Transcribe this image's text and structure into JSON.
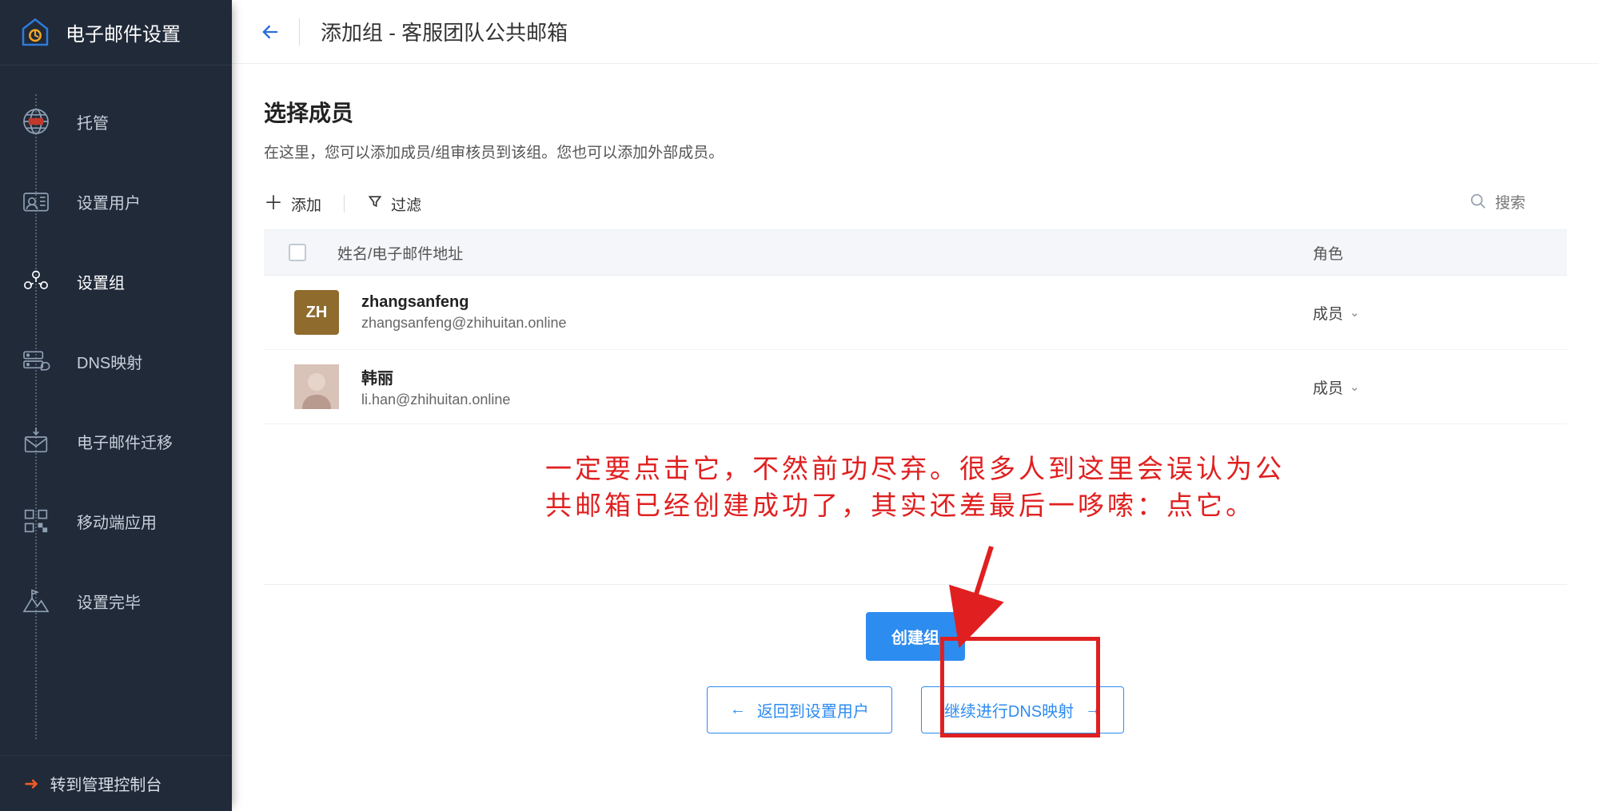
{
  "brand": {
    "title": "电子邮件设置"
  },
  "sidebar": {
    "items": [
      {
        "label": "托管"
      },
      {
        "label": "设置用户"
      },
      {
        "label": "设置组"
      },
      {
        "label": "DNS映射"
      },
      {
        "label": "电子邮件迁移"
      },
      {
        "label": "移动端应用"
      },
      {
        "label": "设置完毕"
      }
    ],
    "footer_label": "转到管理控制台"
  },
  "header": {
    "title": "添加组 - 客服团队公共邮箱"
  },
  "section": {
    "title": "选择成员",
    "desc": "在这里，您可以添加成员/组审核员到该组。您也可以添加外部成员。"
  },
  "toolbar": {
    "add_label": "添加",
    "filter_label": "过滤",
    "search_placeholder": "搜索"
  },
  "table": {
    "col_name": "姓名/电子邮件地址",
    "col_role": "角色",
    "rows": [
      {
        "initials": "ZH",
        "name": "zhangsanfeng",
        "email": "zhangsanfeng@zhihuitan.online",
        "role": "成员",
        "avatar_type": "initials",
        "avatar_color": "#8f6b2d"
      },
      {
        "initials": "",
        "name": "韩丽",
        "email": "li.han@zhihuitan.online",
        "role": "成员",
        "avatar_type": "photo"
      }
    ]
  },
  "annotation": {
    "line1": "一定要点击它，不然前功尽弃。很多人到这里会误认为公",
    "line2": "共邮箱已经创建成功了，其实还差最后一哆嗦：点它。"
  },
  "buttons": {
    "create": "创建组",
    "back": "返回到设置用户",
    "next": "继续进行DNS映射"
  }
}
